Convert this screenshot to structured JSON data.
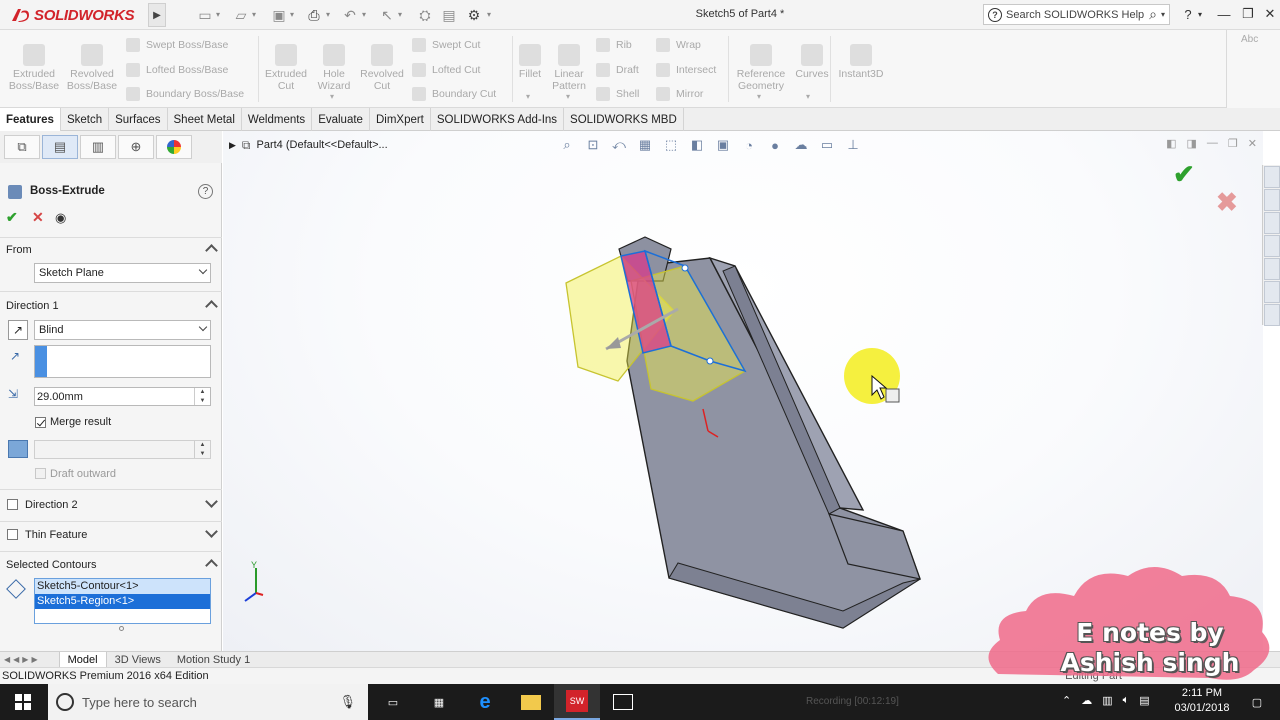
{
  "app": {
    "logo_text": "SOLIDWORKS",
    "doc_title": "Sketch5 of Part4 *",
    "search_placeholder": "Search SOLIDWORKS Help"
  },
  "command_manager": {
    "big_buttons": [
      {
        "label": "Extruded\nBoss/Base",
        "icon": "extrude-boss-icon"
      },
      {
        "label": "Revolved\nBoss/Base",
        "icon": "revolve-boss-icon"
      },
      {
        "label": "Extruded\nCut",
        "icon": "extrude-cut-icon"
      },
      {
        "label": "Hole\nWizard",
        "icon": "hole-wizard-icon"
      },
      {
        "label": "Revolved\nCut",
        "icon": "revolve-cut-icon"
      },
      {
        "label": "Fillet",
        "icon": "fillet-icon"
      },
      {
        "label": "Linear\nPattern",
        "icon": "linear-pattern-icon"
      },
      {
        "label": "Reference\nGeometry",
        "icon": "reference-geometry-icon"
      },
      {
        "label": "Curves",
        "icon": "curves-icon"
      },
      {
        "label": "Instant3D",
        "icon": "instant3d-icon"
      }
    ],
    "small_buttons": {
      "swept_boss": "Swept Boss/Base",
      "lofted_boss": "Lofted Boss/Base",
      "boundary_boss": "Boundary Boss/Base",
      "swept_cut": "Swept Cut",
      "lofted_cut": "Lofted Cut",
      "boundary_cut": "Boundary Cut",
      "rib": "Rib",
      "draft": "Draft",
      "shell": "Shell",
      "wrap": "Wrap",
      "intersect": "Intersect",
      "mirror": "Mirror"
    }
  },
  "tabs": [
    "Features",
    "Sketch",
    "Surfaces",
    "Sheet Metal",
    "Weldments",
    "Evaluate",
    "DimXpert",
    "SOLIDWORKS Add-Ins",
    "SOLIDWORKS MBD"
  ],
  "property_manager": {
    "title": "Boss-Extrude",
    "from": {
      "header": "From",
      "value": "Sketch Plane"
    },
    "direction1": {
      "header": "Direction 1",
      "end_condition": "Blind",
      "depth": "29.00mm",
      "merge_result": "Merge result",
      "draft_outward": "Draft outward"
    },
    "direction2": {
      "header": "Direction 2"
    },
    "thin_feature": {
      "header": "Thin Feature"
    },
    "selected_contours": {
      "header": "Selected Contours",
      "items": [
        "Sketch5-Contour<1>",
        "Sketch5-Region<1>"
      ]
    }
  },
  "viewport": {
    "breadcrumb": "Part4  (Default<<Default>..."
  },
  "bottom_tabs": [
    "Model",
    "3D Views",
    "Motion Study 1"
  ],
  "status_bar": "SOLIDWORKS Premium 2016 x64 Edition",
  "editing_status": "Editing Part",
  "taskbar": {
    "search_placeholder": "Type here to search",
    "recording": "Recording [00:12:19]",
    "time": "2:11 PM",
    "date": "03/01/2018"
  },
  "watermark": {
    "line1": "E notes by",
    "line2": "Ashish singh"
  },
  "colors": {
    "brand_red": "#d2232a",
    "accept_green": "#2ea12e",
    "cancel_red": "#d64545",
    "model_grey": "#8f93a3",
    "preview_yellow": "#f2f04a",
    "selection_blue": "#1c6fd8",
    "watermark_pink": "#f06a8a"
  }
}
